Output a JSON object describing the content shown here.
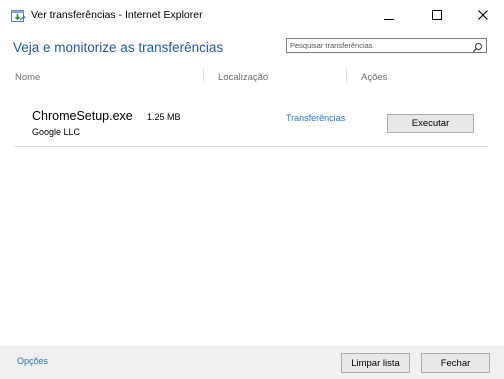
{
  "window": {
    "title": "Ver transferências - Internet Explorer",
    "minimize_icon": "minimize-icon",
    "maximize_icon": "maximize-icon",
    "close_icon": "close-icon"
  },
  "header": {
    "title": "Veja e monitorize as transferências",
    "search_placeholder": "Pesquisar transferências",
    "search_icon": "search-icon"
  },
  "columns": {
    "name": "Nome",
    "location": "Localização",
    "actions": "Ações"
  },
  "downloads": [
    {
      "file_name": "ChromeSetup.exe",
      "size": "1.25 MB",
      "publisher": "Google LLC",
      "location": "Transferências",
      "action_label": "Executar"
    }
  ],
  "footer": {
    "options_label": "Opções",
    "clear_label": "Limpar lista",
    "close_label": "Fechar"
  },
  "colors": {
    "accent": "#1e5ba8",
    "link": "#2b74c4",
    "footer_bg": "#f0f0f0"
  }
}
